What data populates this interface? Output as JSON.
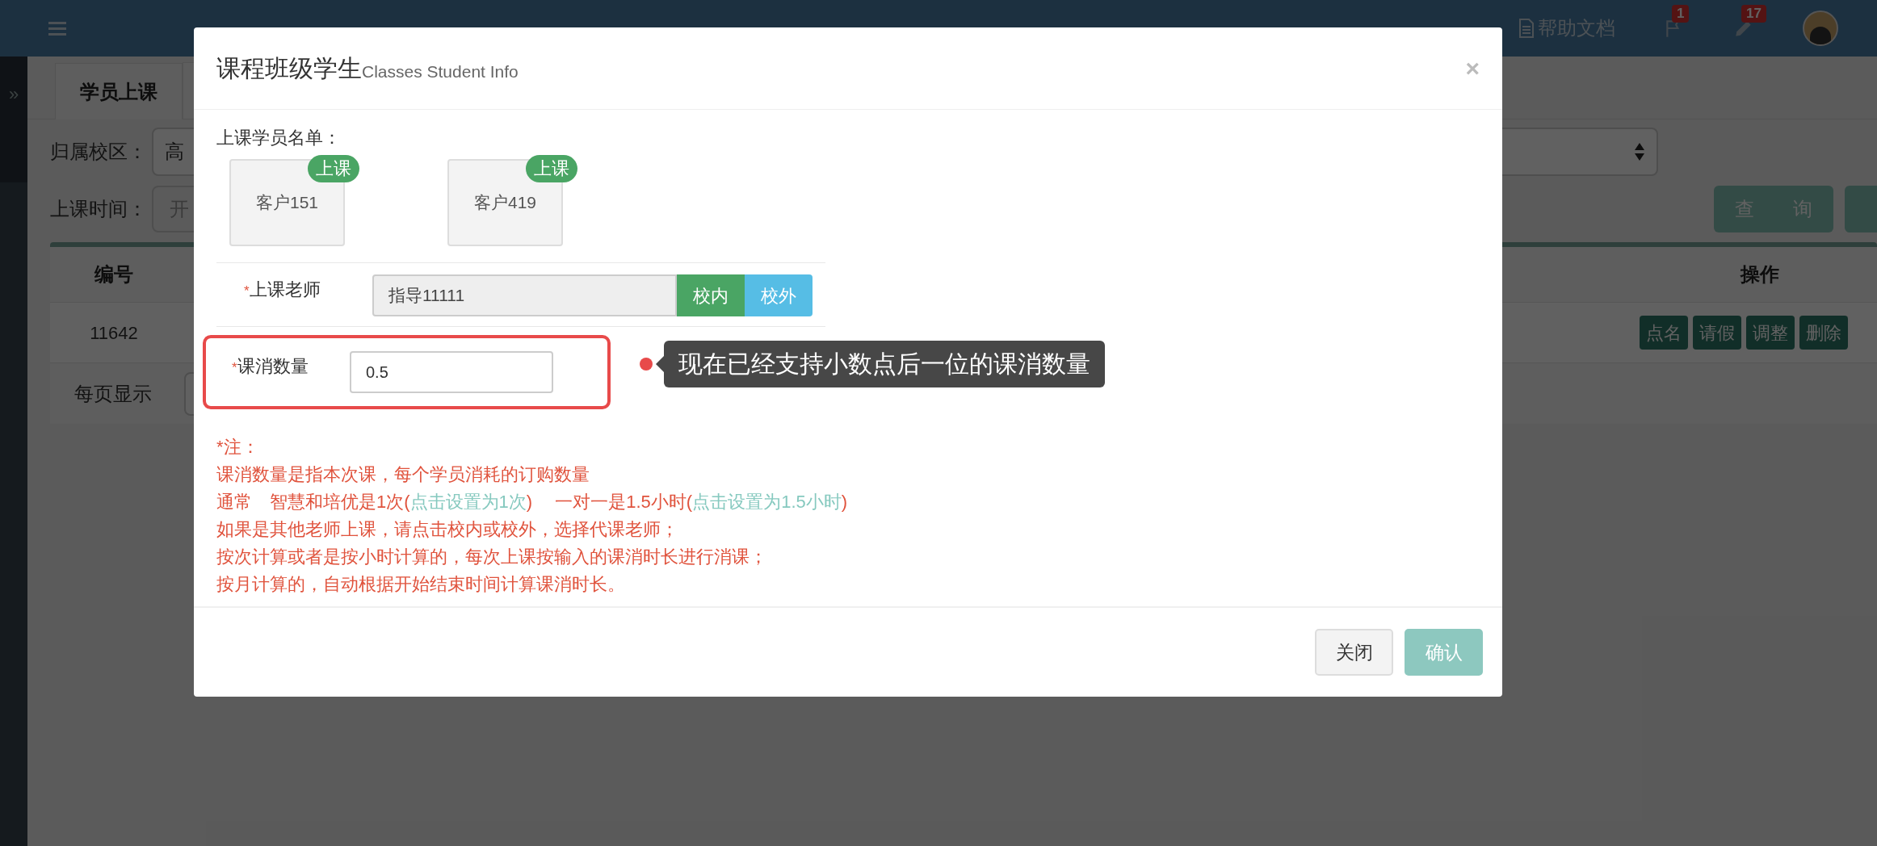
{
  "topbar": {
    "help_label": "帮助文档",
    "badges": [
      {
        "count": "1"
      },
      {
        "count": "17"
      }
    ]
  },
  "sidebar": {
    "toggle": "»"
  },
  "page": {
    "tabs": [
      {
        "label": "学员上课",
        "selected": true
      }
    ],
    "campus_label": "归属校区：",
    "campus_value": "高",
    "time_label": "上课时间：",
    "time_placeholder": "开",
    "query_button": "查　　询",
    "table": {
      "columns": [
        "编号",
        "操作"
      ],
      "rows": [
        {
          "id": "11642",
          "actions": [
            "点名",
            "请假",
            "调整",
            "删除"
          ]
        }
      ]
    },
    "page_size_label": "每页显示"
  },
  "modal": {
    "title": "课程班级学生",
    "subtitle": "Classes Student Info",
    "students_label": "上课学员名单：",
    "students": [
      {
        "name": "客户151",
        "badge": "上课"
      },
      {
        "name": "客户419",
        "badge": "上课"
      }
    ],
    "teacher": {
      "label": "上课老师",
      "required_mark": "*",
      "value": "指导11111",
      "buttons": [
        {
          "label": "校内",
          "kind": "inside"
        },
        {
          "label": "校外",
          "kind": "outside"
        }
      ]
    },
    "quantity": {
      "label": "课消数量",
      "required_mark": "*",
      "value": "0.5",
      "highlighted": true
    },
    "tooltip": "现在已经支持小数点后一位的课消数量",
    "notes": [
      [
        {
          "kind": "text",
          "text": "*注："
        }
      ],
      [
        {
          "kind": "text",
          "text": "课消数量是指本次课，每个学员消耗的订购数量"
        }
      ],
      [
        {
          "kind": "text",
          "text": "通常　智慧和培优是1次("
        },
        {
          "kind": "link",
          "text": "点击设置为1次"
        },
        {
          "kind": "text",
          "text": ")　 一对一是1.5小时("
        },
        {
          "kind": "link",
          "text": "点击设置为1.5小时"
        },
        {
          "kind": "text",
          "text": ")"
        }
      ],
      [
        {
          "kind": "text",
          "text": "如果是其他老师上课，请点击校内或校外，选择代课老师；"
        }
      ],
      [
        {
          "kind": "text",
          "text": "按次计算或者是按小时计算的，每次上课按输入的课消时长进行消课；"
        }
      ],
      [
        {
          "kind": "text",
          "text": "按月计算的，自动根据开始结束时间计算课消时长。"
        }
      ]
    ],
    "close_symbol": "×",
    "buttons": [
      {
        "label": "关闭",
        "kind": "default"
      },
      {
        "label": "确认",
        "kind": "primary"
      }
    ]
  }
}
